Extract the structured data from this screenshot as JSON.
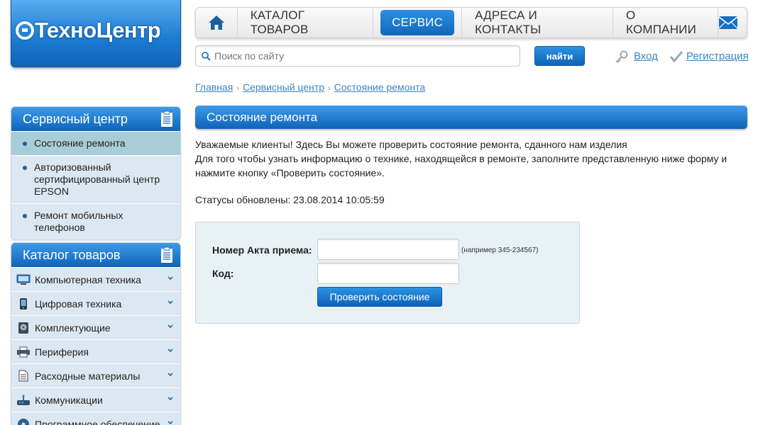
{
  "logo": {
    "text": "ТехноЦентр"
  },
  "nav": {
    "items": [
      {
        "label": "КАТАЛОГ ТОВАРОВ"
      },
      {
        "label": "СЕРВИС"
      },
      {
        "label": "АДРЕСА И КОНТАКТЫ"
      },
      {
        "label": "О КОМПАНИИ"
      }
    ],
    "active_index": 1
  },
  "search": {
    "placeholder": "Поиск по сайту",
    "value": "",
    "button_label": "найти"
  },
  "auth": {
    "login": "Вход",
    "register": "Регистрация"
  },
  "breadcrumb": [
    "Главная",
    "Сервисный центр",
    "Состояние ремонта"
  ],
  "service_panel": {
    "title": "Сервисный центр",
    "items": [
      {
        "label": "Состояние ремонта",
        "active": true
      },
      {
        "label": "Авторизованный сертифицированный центр EPSON",
        "active": false
      },
      {
        "label": "Ремонт мобильных телефонов",
        "active": false
      }
    ]
  },
  "catalog_panel": {
    "title": "Каталог товаров",
    "items": [
      {
        "label": "Компьютерная техника",
        "icon": "monitor-icon"
      },
      {
        "label": "Цифровая техника",
        "icon": "phone-icon"
      },
      {
        "label": "Комплектующие",
        "icon": "harddrive-icon"
      },
      {
        "label": "Периферия",
        "icon": "printer-icon"
      },
      {
        "label": "Расходные материалы",
        "icon": "document-icon"
      },
      {
        "label": "Коммуникации",
        "icon": "router-icon"
      },
      {
        "label": "Программное обеспечение",
        "icon": "disc-icon"
      }
    ]
  },
  "main": {
    "title": "Состояние ремонта",
    "intro_line1": "Уважаемые клиенты! Здесь Вы можете проверить состояние ремонта, сданного нам изделия",
    "intro_line2": "Для того чтобы узнать информацию о технике, находящейся в ремонте, заполните представленную ниже форму и нажмите кнопку «Проверить состояние».",
    "status_label": "Статусы обновлены: 23.08.2014 10:05:59"
  },
  "form": {
    "act_label": "Номер Акта приема:",
    "act_value": "",
    "act_hint": "(например 345-234567)",
    "code_label": "Код:",
    "code_value": "",
    "submit_label": "Проверить состояние"
  },
  "colors": {
    "accent_blue": "#1673c8",
    "link": "#3a86c4",
    "panel_bg": "#dce8f1",
    "form_bg": "#e8f1f5"
  }
}
